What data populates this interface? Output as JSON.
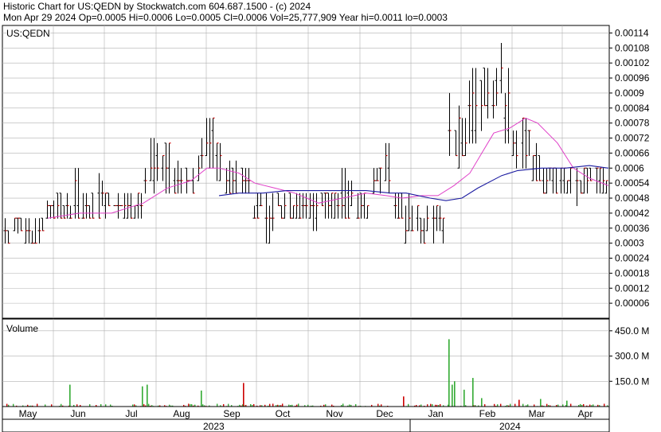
{
  "header": {
    "line1": "Historic Chart for US:QEDN by Stockwatch.com 604.687.1500 - (c) 2024",
    "line2": "Mon Apr 29 2024   Op=0.0005   Hi=0.0006   Lo=0.0005   Cl=0.0006   Vol=25,777,909   Year hi=0.0011   lo=0.0003"
  },
  "price_panel_label": "US:QEDN",
  "volume_panel_label": "Volume",
  "colors": {
    "bar": "#000000",
    "close_tick": "#cc0000",
    "ma_short": "#e040c8",
    "ma_long": "#1a1aa0",
    "volume_up": "#33aa33",
    "volume_down": "#cc0000",
    "grid": "#b0b0b0"
  },
  "chart_data": [
    {
      "type": "ohlc",
      "title": "",
      "ylim": [
        0,
        0.00117
      ],
      "y_ticks": [
        "0.00114",
        "0.00108",
        "0.00102",
        "0.00096",
        "0.0009",
        "0.00084",
        "0.00078",
        "0.00072",
        "0.00066",
        "0.0006",
        "0.00054",
        "0.00048",
        "0.00042",
        "0.00036",
        "0.0003",
        "0.00024",
        "0.00018",
        "0.00012",
        "0.00006"
      ],
      "y_tick_values": [
        0.00114,
        0.00108,
        0.00102,
        0.00096,
        0.0009,
        0.00084,
        0.00078,
        0.00072,
        0.00066,
        0.0006,
        0.00054,
        0.00048,
        0.00042,
        0.00036,
        0.0003,
        0.00024,
        0.00018,
        0.00012,
        6e-05
      ],
      "x_months": [
        "May",
        "Jun",
        "Jul",
        "Aug",
        "Sep",
        "Oct",
        "Nov",
        "Dec",
        "Jan",
        "Feb",
        "Mar",
        "Apr"
      ],
      "x_years": [
        "2023",
        "2024"
      ],
      "grid": true,
      "price_segments": [
        {
          "from": 0,
          "to": 2,
          "low": 0.00043,
          "high": 0.00048
        },
        {
          "from": 2,
          "to": 14,
          "low": 0.0003,
          "high": 0.0004
        },
        {
          "from": 14,
          "to": 28,
          "low": 0.00034,
          "high": 0.0004
        },
        {
          "from": 28,
          "to": 45,
          "low": 0.0003,
          "high": 0.0004
        },
        {
          "from": 45,
          "to": 55,
          "low": 0.0003,
          "high": 0.0004
        },
        {
          "from": 55,
          "to": 68,
          "low": 0.0004,
          "high": 0.00047
        },
        {
          "from": 68,
          "to": 90,
          "low": 0.0004,
          "high": 0.0005
        },
        {
          "from": 90,
          "to": 100,
          "low": 0.0004,
          "high": 0.00058
        },
        {
          "from": 100,
          "to": 120,
          "low": 0.0004,
          "high": 0.0005
        },
        {
          "from": 120,
          "to": 140,
          "low": 0.0004,
          "high": 0.00058
        },
        {
          "from": 140,
          "to": 165,
          "low": 0.0004,
          "high": 0.0005
        },
        {
          "from": 165,
          "to": 178,
          "low": 0.0004,
          "high": 0.0005
        },
        {
          "from": 178,
          "to": 185,
          "low": 0.0005,
          "high": 0.0006
        },
        {
          "from": 185,
          "to": 200,
          "low": 0.0005,
          "high": 0.00072
        },
        {
          "from": 200,
          "to": 215,
          "low": 0.0005,
          "high": 0.0007
        },
        {
          "from": 215,
          "to": 230,
          "low": 0.0005,
          "high": 0.00063
        },
        {
          "from": 230,
          "to": 245,
          "low": 0.0005,
          "high": 0.0006
        },
        {
          "from": 245,
          "to": 255,
          "low": 0.00055,
          "high": 0.00072
        },
        {
          "from": 255,
          "to": 268,
          "low": 0.0006,
          "high": 0.0008
        },
        {
          "from": 268,
          "to": 280,
          "low": 0.00055,
          "high": 0.0007
        },
        {
          "from": 280,
          "to": 300,
          "low": 0.0005,
          "high": 0.00063
        },
        {
          "from": 300,
          "to": 315,
          "low": 0.0005,
          "high": 0.0006
        },
        {
          "from": 315,
          "to": 330,
          "low": 0.0004,
          "high": 0.0005
        },
        {
          "from": 330,
          "to": 345,
          "low": 0.0003,
          "high": 0.0005
        },
        {
          "from": 345,
          "to": 360,
          "low": 0.0004,
          "high": 0.0005
        },
        {
          "from": 360,
          "to": 385,
          "low": 0.0004,
          "high": 0.0005
        },
        {
          "from": 385,
          "to": 400,
          "low": 0.00035,
          "high": 0.0005
        },
        {
          "from": 400,
          "to": 425,
          "low": 0.0004,
          "high": 0.0005
        },
        {
          "from": 425,
          "to": 445,
          "low": 0.0004,
          "high": 0.0006
        },
        {
          "from": 445,
          "to": 465,
          "low": 0.0004,
          "high": 0.0005
        },
        {
          "from": 465,
          "to": 480,
          "low": 0.0005,
          "high": 0.0006
        },
        {
          "from": 480,
          "to": 492,
          "low": 0.0005,
          "high": 0.0007
        },
        {
          "from": 492,
          "to": 505,
          "low": 0.0004,
          "high": 0.0005
        },
        {
          "from": 505,
          "to": 520,
          "low": 0.0003,
          "high": 0.0005
        },
        {
          "from": 520,
          "to": 540,
          "low": 0.0003,
          "high": 0.00045
        },
        {
          "from": 540,
          "to": 560,
          "low": 0.0003,
          "high": 0.00045
        },
        {
          "from": 560,
          "to": 568,
          "low": 0.00055,
          "high": 0.0009
        },
        {
          "from": 568,
          "to": 585,
          "low": 0.0006,
          "high": 0.00085
        },
        {
          "from": 585,
          "to": 600,
          "low": 0.0007,
          "high": 0.001
        },
        {
          "from": 600,
          "to": 615,
          "low": 0.00075,
          "high": 0.001
        },
        {
          "from": 615,
          "to": 625,
          "low": 0.0008,
          "high": 0.001
        },
        {
          "from": 625,
          "to": 630,
          "low": 0.0009,
          "high": 0.0011
        },
        {
          "from": 630,
          "to": 640,
          "low": 0.0007,
          "high": 0.001
        },
        {
          "from": 640,
          "to": 652,
          "low": 0.0006,
          "high": 0.0008
        },
        {
          "from": 652,
          "to": 665,
          "low": 0.0006,
          "high": 0.0008
        },
        {
          "from": 665,
          "to": 678,
          "low": 0.00055,
          "high": 0.0007
        },
        {
          "from": 678,
          "to": 700,
          "low": 0.0005,
          "high": 0.0006
        },
        {
          "from": 700,
          "to": 720,
          "low": 0.0005,
          "high": 0.0006
        },
        {
          "from": 720,
          "to": 725,
          "low": 0.00045,
          "high": 0.0006
        },
        {
          "from": 725,
          "to": 745,
          "low": 0.0005,
          "high": 0.0006
        },
        {
          "from": 745,
          "to": 764,
          "low": 0.0005,
          "high": 0.0006
        }
      ],
      "ma_short": [
        [
          275,
          0.0006
        ],
        [
          300,
          0.00058
        ],
        [
          320,
          0.00054
        ],
        [
          345,
          0.00052
        ],
        [
          370,
          0.0005
        ],
        [
          400,
          0.00046
        ],
        [
          430,
          0.00048
        ],
        [
          460,
          0.0005
        ],
        [
          485,
          0.00049
        ],
        [
          505,
          0.00048
        ],
        [
          530,
          0.00049
        ],
        [
          550,
          0.00049
        ],
        [
          570,
          0.00053
        ],
        [
          590,
          0.00058
        ],
        [
          605,
          0.00066
        ],
        [
          620,
          0.00074
        ],
        [
          640,
          0.00076
        ],
        [
          660,
          0.0008
        ],
        [
          675,
          0.00078
        ],
        [
          700,
          0.0007
        ],
        [
          720,
          0.0006
        ],
        [
          740,
          0.00056
        ],
        [
          764,
          0.00053
        ]
      ],
      "ma_short_early": [
        [
          60,
          0.0004
        ],
        [
          100,
          0.00042
        ],
        [
          140,
          0.00042
        ],
        [
          180,
          0.00046
        ],
        [
          210,
          0.00052
        ],
        [
          240,
          0.00055
        ],
        [
          260,
          0.0006
        ],
        [
          275,
          0.0006
        ]
      ],
      "ma_long": [
        [
          275,
          0.00049
        ],
        [
          300,
          0.0005
        ],
        [
          330,
          0.0005
        ],
        [
          360,
          0.00051
        ],
        [
          400,
          0.00051
        ],
        [
          430,
          0.00051
        ],
        [
          460,
          0.00051
        ],
        [
          490,
          0.0005
        ],
        [
          510,
          0.0005
        ],
        [
          540,
          0.00048
        ],
        [
          560,
          0.00047
        ],
        [
          580,
          0.00048
        ],
        [
          600,
          0.00052
        ],
        [
          630,
          0.00057
        ],
        [
          650,
          0.00059
        ],
        [
          680,
          0.0006
        ],
        [
          710,
          0.0006
        ],
        [
          740,
          0.00061
        ],
        [
          764,
          0.0006
        ]
      ]
    },
    {
      "type": "bar",
      "title": "Volume",
      "y_ticks": [
        "450.0 M",
        "300.0 M",
        "150.0 M"
      ],
      "y_tick_values": [
        450,
        300,
        150
      ],
      "ylim": [
        0,
        520
      ],
      "unit": "M",
      "notable_bars": [
        {
          "x": 87,
          "value": 130,
          "color": "up"
        },
        {
          "x": 178,
          "value": 120,
          "color": "up"
        },
        {
          "x": 184,
          "value": 130,
          "color": "up"
        },
        {
          "x": 252,
          "value": 95,
          "color": "up"
        },
        {
          "x": 305,
          "value": 140,
          "color": "down"
        },
        {
          "x": 506,
          "value": 60,
          "color": "down"
        },
        {
          "x": 563,
          "value": 400,
          "color": "up"
        },
        {
          "x": 567,
          "value": 130,
          "color": "up"
        },
        {
          "x": 570,
          "value": 150,
          "color": "up"
        },
        {
          "x": 582,
          "value": 100,
          "color": "up"
        },
        {
          "x": 593,
          "value": 170,
          "color": "up"
        },
        {
          "x": 604,
          "value": 50,
          "color": "up"
        },
        {
          "x": 651,
          "value": 40,
          "color": "down"
        },
        {
          "x": 678,
          "value": 45,
          "color": "up"
        },
        {
          "x": 711,
          "value": 35,
          "color": "up"
        }
      ]
    }
  ]
}
